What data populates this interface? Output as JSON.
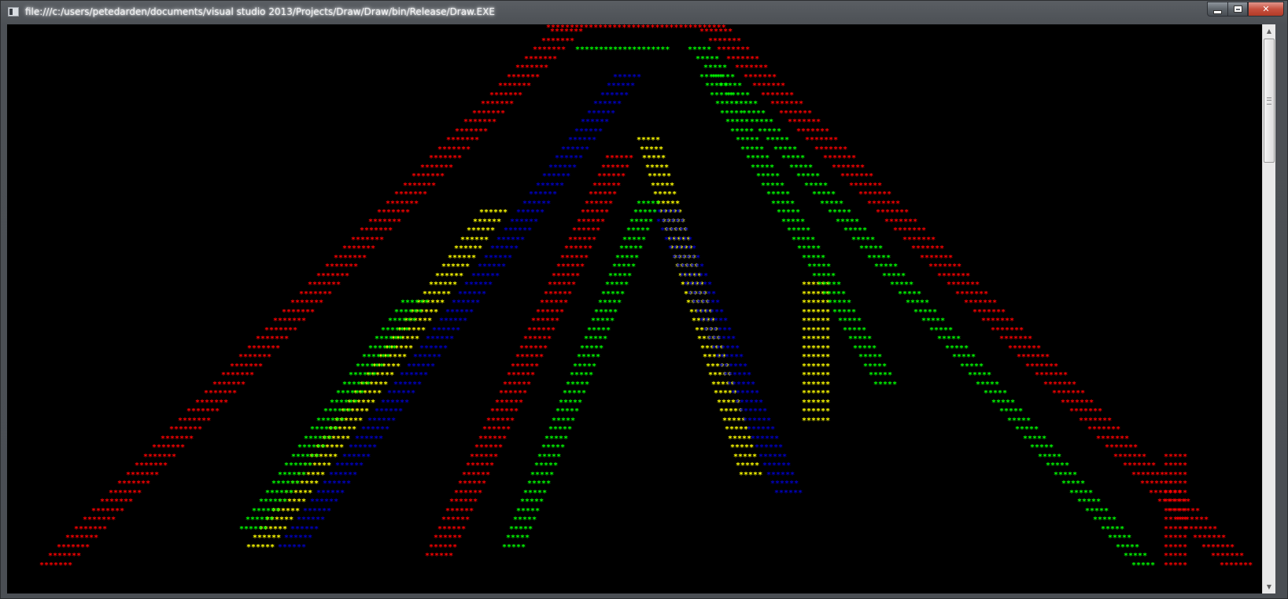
{
  "window": {
    "title": "file:///c:/users/petedarden/documents/visual studio 2013/Projects/Draw/Draw/bin/Release/Draw.EXE"
  },
  "caption_buttons": {
    "minimize_icon": "minimize-icon",
    "maximize_icon": "maximize-icon",
    "close_label": "✕"
  },
  "scrollbar": {
    "up_arrow": "▲",
    "down_arrow": "▼"
  },
  "colors": {
    "background": "#000000",
    "red": "#ff0000",
    "green": "#00ff00",
    "blue": "#0000c8",
    "yellow": "#ffff00"
  },
  "console": {
    "glyph": "*",
    "pattern_description_is_not_shown": false
  }
}
